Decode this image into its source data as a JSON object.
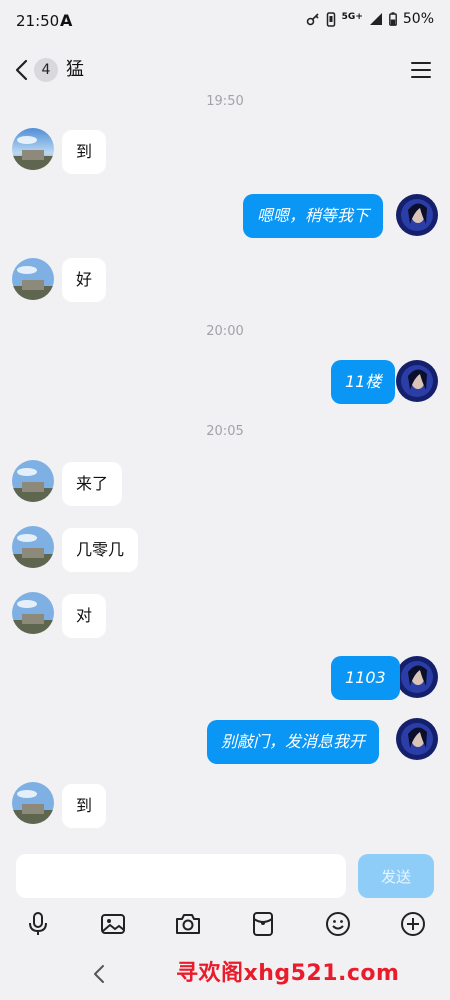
{
  "status_bar": {
    "time": "21:50",
    "notification_glyph": "A",
    "network_label": "5G+",
    "battery_percent": "50%"
  },
  "header": {
    "unread_count": "4",
    "contact_name": "猛"
  },
  "messages": [
    {
      "type": "timestamp",
      "text": "19:50"
    },
    {
      "type": "incoming",
      "text": "到"
    },
    {
      "type": "outgoing",
      "text": "嗯嗯，稍等我下"
    },
    {
      "type": "incoming",
      "text": "好"
    },
    {
      "type": "timestamp",
      "text": "20:00"
    },
    {
      "type": "outgoing",
      "text": "11楼"
    },
    {
      "type": "timestamp",
      "text": "20:05"
    },
    {
      "type": "incoming",
      "text": "来了"
    },
    {
      "type": "incoming",
      "text": "几零几"
    },
    {
      "type": "incoming",
      "text": "对"
    },
    {
      "type": "outgoing",
      "text": "1103"
    },
    {
      "type": "outgoing",
      "text": "别敲门，发消息我开"
    },
    {
      "type": "incoming",
      "text": "到"
    }
  ],
  "composer": {
    "input_value": "",
    "send_label": "发送"
  },
  "toolbar": {
    "icons": [
      "microphone-icon",
      "image-icon",
      "camera-icon",
      "red-packet-icon",
      "emoji-icon",
      "plus-icon"
    ]
  },
  "watermark": "寻欢阁xhg521.com",
  "colors": {
    "outgoing_bubble": "#0a96f5",
    "incoming_bubble": "#ffffff",
    "background": "#f1f1f3",
    "send_button_disabled": "#8fcdf9",
    "watermark": "#ea1c2b"
  }
}
